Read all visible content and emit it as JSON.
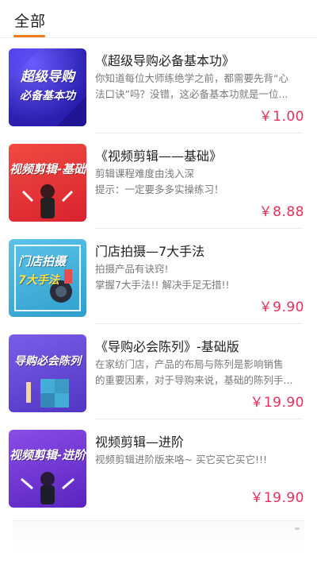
{
  "tabs": {
    "active_label": "全部"
  },
  "colors": {
    "accent": "#f07b1d",
    "price": "#e8305a"
  },
  "courses": [
    {
      "title": "《超级导购必备基本功》",
      "desc_lines": [
        "你知道每位大师练绝学之前，都需要先背“心",
        "法口诀”吗？没错，这必备基本功就是一位..."
      ],
      "price": "￥1.00",
      "thumb_text": [
        "超级导购",
        "必备基本功"
      ],
      "thumb_bg": "#3d2fc7"
    },
    {
      "title": "《视频剪辑——基础》",
      "desc_lines": [
        "剪辑课程难度由浅入深",
        " 提示：一定要多多实操练习！"
      ],
      "price": "￥8.88",
      "thumb_text": [
        "视频剪辑-基础"
      ],
      "thumb_bg": "#e8373a"
    },
    {
      "title": "门店拍摄—7大手法",
      "desc_lines": [
        "拍摄产品有诀窍!",
        "掌握7大手法!! 解决手足无措!!"
      ],
      "price": "￥9.90",
      "thumb_text": [
        "门店拍摄",
        "7大手法"
      ],
      "thumb_bg": "#48b3d9"
    },
    {
      "title": "《导购必会陈列》-基础版",
      "desc_lines": [
        "在家纺门店，产品的布局与陈列是影响销售",
        "的重要因素，对于导购来说，基础的陈列手..."
      ],
      "price": "￥19.90",
      "thumb_text": [
        "导购必会陈列"
      ],
      "thumb_bg": "#6c4fd6"
    },
    {
      "title": "视频剪辑—进阶",
      "desc_lines": [
        "视频剪辑进阶版来咯~ 买它买它买它!!!"
      ],
      "price": "￥19.90",
      "thumb_text": [
        "视频剪辑-进阶"
      ],
      "thumb_bg": "#7a3ad8"
    }
  ]
}
